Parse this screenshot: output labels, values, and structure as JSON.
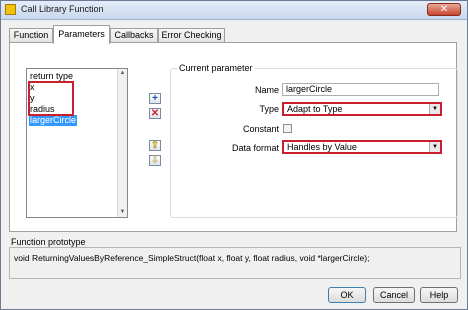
{
  "window": {
    "title": "Call Library Function",
    "close_glyph": "✕",
    "app_icon": "labview-icon"
  },
  "tabs": [
    {
      "label": "Function"
    },
    {
      "label": "Parameters"
    },
    {
      "label": "Callbacks"
    },
    {
      "label": "Error Checking"
    }
  ],
  "active_tab": "Parameters",
  "param_list": {
    "items": [
      "return type",
      "x",
      "y",
      "radius",
      "largerCircle"
    ],
    "selected": "largerCircle"
  },
  "side_buttons": {
    "add": "+",
    "remove": "✕",
    "up": "⇧",
    "down": "⇩"
  },
  "current_parameter": {
    "legend": "Current parameter",
    "name_label": "Name",
    "name_value": "largerCircle",
    "type_label": "Type",
    "type_value": "Adapt to Type",
    "constant_label": "Constant",
    "constant_checked": false,
    "data_format_label": "Data format",
    "data_format_value": "Handles by Value"
  },
  "prototype": {
    "label": "Function prototype",
    "text": "void  ReturningValuesByReference_SimpleStruct(float x, float y, float radius, void *largerCircle);"
  },
  "buttons": {
    "ok": "OK",
    "cancel": "Cancel",
    "help": "Help"
  },
  "colors": {
    "highlight": "#cc1f2e",
    "selection": "#3399ff"
  }
}
